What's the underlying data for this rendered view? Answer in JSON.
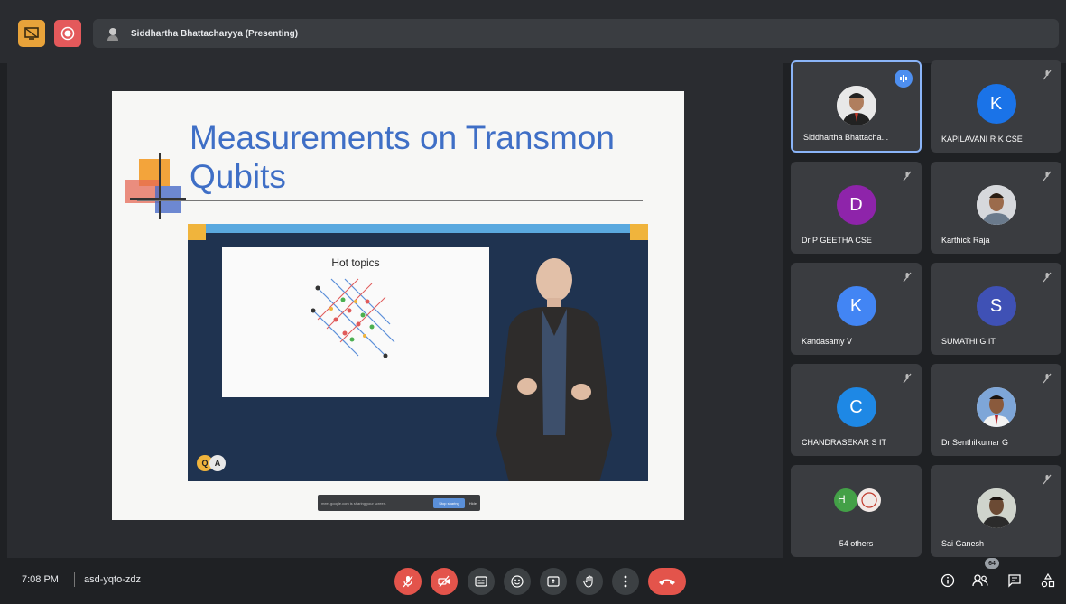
{
  "header": {
    "presenting_text": "Siddhartha Bhattacharyya (Presenting)",
    "present_icon": "present-screen-icon",
    "record_icon": "record-icon",
    "colors": {
      "present": "#e8a33a",
      "record": "#e4595b"
    }
  },
  "slide": {
    "title": "Measurements on Transmon Qubits",
    "whiteboard_title": "Hot topics",
    "qa_badge": {
      "q": "Q",
      "a": "A"
    },
    "share_bar": {
      "text": "meet.google.com is sharing your screen.",
      "stop_label": "Stop sharing",
      "hide_label": "Hide"
    }
  },
  "participants": [
    {
      "name": "Siddhartha Bhattacha...",
      "initial": "",
      "avatar_color": "",
      "type": "photo",
      "speaking": true
    },
    {
      "name": "KAPILAVANI R K CSE",
      "initial": "K",
      "avatar_color": "#1a73e8",
      "type": "initial",
      "muted": true
    },
    {
      "name": "Dr P GEETHA CSE",
      "initial": "D",
      "avatar_color": "#8e24aa",
      "type": "initial",
      "muted": true
    },
    {
      "name": "Karthick Raja",
      "initial": "",
      "avatar_color": "",
      "type": "photo",
      "muted": true
    },
    {
      "name": "Kandasamy V",
      "initial": "K",
      "avatar_color": "#4285f4",
      "type": "initial",
      "muted": true
    },
    {
      "name": "SUMATHI G IT",
      "initial": "S",
      "avatar_color": "#3f51b5",
      "type": "initial",
      "muted": true
    },
    {
      "name": "CHANDRASEKAR S IT",
      "initial": "C",
      "avatar_color": "#1e88e5",
      "type": "initial",
      "muted": true
    },
    {
      "name": "Dr Senthilkumar G",
      "initial": "",
      "avatar_color": "",
      "type": "photo",
      "muted": true
    },
    {
      "name": "54 others",
      "initial": "H",
      "avatar_color": "#43a047",
      "type": "others"
    },
    {
      "name": "Sai Ganesh",
      "initial": "",
      "avatar_color": "",
      "type": "photo",
      "muted": true
    }
  ],
  "footer": {
    "time": "7:08 PM",
    "meeting_code": "asd-yqto-zdz",
    "people_count": "64",
    "controls": [
      {
        "name": "mic-off-icon",
        "state": "off"
      },
      {
        "name": "camera-off-icon",
        "state": "off"
      },
      {
        "name": "captions-icon"
      },
      {
        "name": "emoji-icon"
      },
      {
        "name": "present-now-icon"
      },
      {
        "name": "raise-hand-icon"
      },
      {
        "name": "more-options-icon"
      },
      {
        "name": "end-call-icon"
      }
    ],
    "right_controls": [
      "info-icon",
      "people-icon",
      "chat-icon",
      "activities-icon"
    ]
  }
}
